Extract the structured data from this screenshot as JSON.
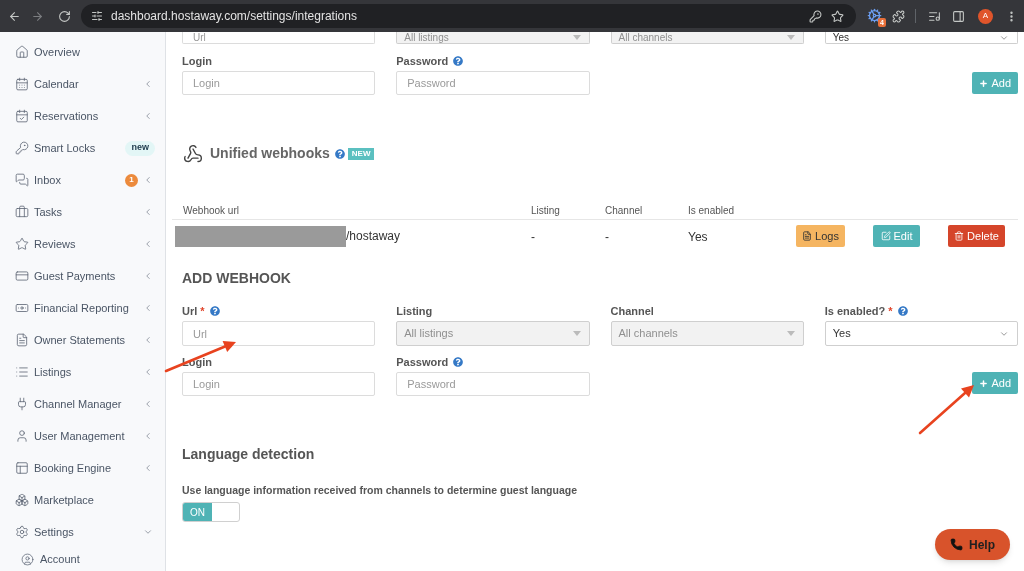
{
  "browser": {
    "url": "dashboard.hostaway.com/settings/integrations",
    "extension_badge": "4",
    "profile_initial": "A"
  },
  "sidebar": {
    "items": [
      {
        "label": "Overview"
      },
      {
        "label": "Calendar",
        "expanded": false
      },
      {
        "label": "Reservations",
        "expanded": false
      },
      {
        "label": "Smart Locks",
        "badge": {
          "kind": "tag",
          "text": "new"
        }
      },
      {
        "label": "Inbox",
        "badge": {
          "kind": "count",
          "text": "1"
        },
        "expanded": false
      },
      {
        "label": "Tasks",
        "expanded": false
      },
      {
        "label": "Reviews",
        "expanded": false
      },
      {
        "label": "Guest Payments",
        "expanded": false
      },
      {
        "label": "Financial Reporting",
        "expanded": false
      },
      {
        "label": "Owner Statements",
        "expanded": false
      },
      {
        "label": "Listings",
        "expanded": false
      },
      {
        "label": "Channel Manager",
        "expanded": false
      },
      {
        "label": "User Management",
        "expanded": false
      },
      {
        "label": "Booking Engine",
        "expanded": false
      },
      {
        "label": "Marketplace"
      },
      {
        "label": "Settings",
        "expanded": true,
        "children": [
          {
            "label": "Account"
          }
        ]
      }
    ]
  },
  "previous_form": {
    "cut_row": [
      {
        "kind": "input",
        "placeholder": "Url"
      },
      {
        "kind": "select",
        "value": "All listings",
        "disabled": true
      },
      {
        "kind": "select",
        "value": "All channels",
        "disabled": true
      },
      {
        "kind": "select",
        "value": "Yes",
        "disabled": false
      }
    ],
    "credentials": [
      {
        "label": "Login",
        "kind": "input",
        "placeholder": "Login"
      },
      {
        "label": "Password",
        "help": true,
        "kind": "input",
        "placeholder": "Password"
      }
    ],
    "add_button": "Add"
  },
  "webhooks": {
    "title": "Unified webhooks",
    "help": true,
    "badge": "NEW",
    "columns": [
      "Webhook url",
      "Listing",
      "Channel",
      "Is enabled"
    ],
    "rows": [
      {
        "url_redacted": true,
        "url": "/hostaway",
        "listing": "-",
        "channel": "-",
        "enabled": "Yes",
        "actions": [
          {
            "kind": "logs",
            "label": "Logs"
          },
          {
            "kind": "edit",
            "label": "Edit"
          },
          {
            "kind": "delete",
            "label": "Delete"
          }
        ]
      }
    ]
  },
  "add_webhook": {
    "title": "ADD WEBHOOK",
    "fields": [
      {
        "label": "Url",
        "required_mark": "*",
        "help": true,
        "kind": "input",
        "placeholder": "Url"
      },
      {
        "label": "Listing",
        "kind": "select",
        "value": "All listings",
        "disabled": true
      },
      {
        "label": "Channel",
        "kind": "select",
        "value": "All channels",
        "disabled": true
      },
      {
        "label": "Is enabled?",
        "required_mark": "*",
        "help": true,
        "kind": "select",
        "value": "Yes",
        "disabled": false
      }
    ],
    "credentials": [
      {
        "label": "Login",
        "kind": "input",
        "placeholder": "Login"
      },
      {
        "label": "Password",
        "help": true,
        "kind": "input",
        "placeholder": "Password"
      }
    ],
    "add_button": "Add"
  },
  "language_detection": {
    "title": "Language detection",
    "label": "Use language information received from channels to determine guest language",
    "on": true,
    "on_label": "ON"
  },
  "help_button": {
    "label": "Help"
  }
}
